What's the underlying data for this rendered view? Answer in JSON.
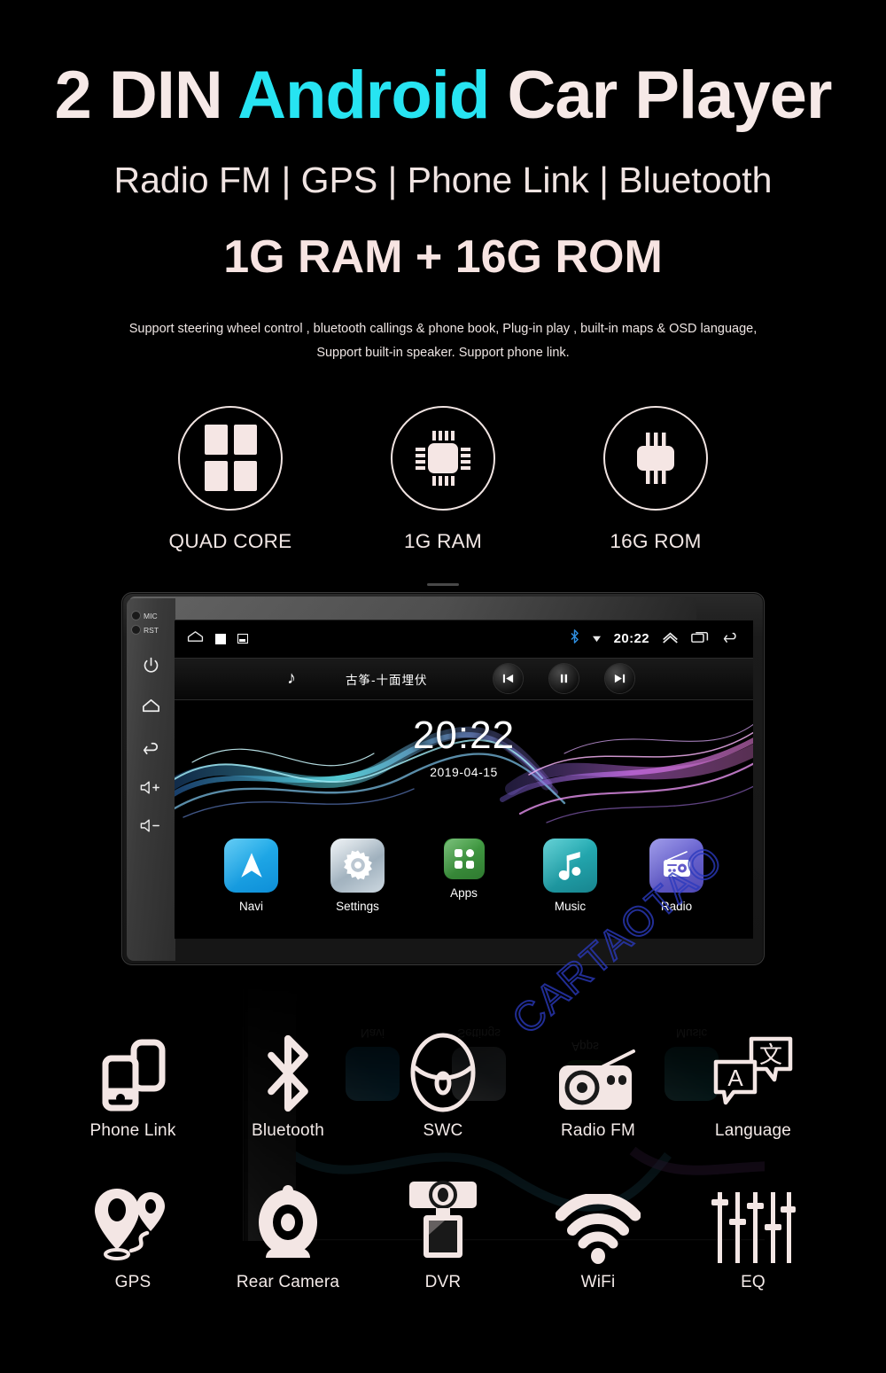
{
  "hero": {
    "title_pre": "2 DIN ",
    "title_accent": "Android",
    "title_post": " Car Player",
    "subtitle": "Radio FM | GPS | Phone Link | Bluetooth",
    "ramrom": "1G RAM + 16G ROM",
    "support_line1": "Support steering wheel control , bluetooth callings & phone book,  Plug-in play , built-in maps & OSD language,",
    "support_line2": "Support built-in speaker. Support phone link.",
    "accent_color": "#27e4f2",
    "text_color": "#f3e8e6"
  },
  "specs": [
    {
      "label": "QUAD CORE",
      "icon": "quad-core-icon"
    },
    {
      "label": "1G RAM",
      "icon": "chip-icon"
    },
    {
      "label": "16G ROM",
      "icon": "memory-chip-icon"
    }
  ],
  "device": {
    "side_buttons": [
      {
        "label": "MIC",
        "icon": "mic-dot-icon"
      },
      {
        "label": "RST",
        "icon": "reset-dot-icon"
      },
      {
        "label": "",
        "icon": "power-icon"
      },
      {
        "label": "",
        "icon": "home-icon"
      },
      {
        "label": "",
        "icon": "back-icon"
      },
      {
        "label": "",
        "icon": "volume-up-icon"
      },
      {
        "label": "",
        "icon": "volume-down-icon"
      }
    ],
    "statusbar": {
      "left_icons": [
        "home-icon",
        "stop-square-icon",
        "screenshot-icon"
      ],
      "bluetooth_icon": "bluetooth-icon",
      "dropdown_icon": "triangle-down-icon",
      "time": "20:22",
      "right_icons": [
        "chevron-up-icon",
        "recents-icon",
        "back-arrow-icon"
      ],
      "bluetooth_color": "#2f8fe0"
    },
    "mediabar": {
      "note_icon": "music-note-icon",
      "track_title": "古筝-十面埋伏",
      "controls": [
        "previous-track-icon",
        "pause-icon",
        "next-track-icon"
      ]
    },
    "wallpaper": {
      "clock_time": "20:22",
      "clock_date": "2019-04-15",
      "left_wave_color": "#4fe0e8",
      "right_wave_color": "#c46ae0"
    },
    "apps": [
      {
        "label": "Navi",
        "icon": "navigation-arrow-icon",
        "color": "#1aa5e6"
      },
      {
        "label": "Settings",
        "icon": "gear-icon",
        "color": "#c3ced8"
      },
      {
        "label": "Apps",
        "icon": "app-grid-icon",
        "color": "#3e9440"
      },
      {
        "label": "Music",
        "icon": "music-note-icon",
        "color": "#21a3ab"
      },
      {
        "label": "Radio",
        "icon": "radio-icon",
        "color": "#6159c9"
      }
    ]
  },
  "features": {
    "row1": [
      {
        "label": "Phone Link",
        "icon": "phone-link-icon"
      },
      {
        "label": "Bluetooth",
        "icon": "bluetooth-icon"
      },
      {
        "label": "SWC",
        "icon": "steering-wheel-icon"
      },
      {
        "label": "Radio  FM",
        "icon": "radio-icon"
      },
      {
        "label": "Language",
        "icon": "translate-icon"
      }
    ],
    "row2": [
      {
        "label": "GPS",
        "icon": "map-pin-icon"
      },
      {
        "label": "Rear Camera",
        "icon": "camera-icon"
      },
      {
        "label": "DVR",
        "icon": "dvr-camera-icon"
      },
      {
        "label": "WiFi",
        "icon": "wifi-icon"
      },
      {
        "label": "EQ",
        "icon": "equalizer-icon"
      }
    ]
  },
  "watermark": {
    "text": "CARTAOTAO",
    "color": "#2a3abe"
  }
}
